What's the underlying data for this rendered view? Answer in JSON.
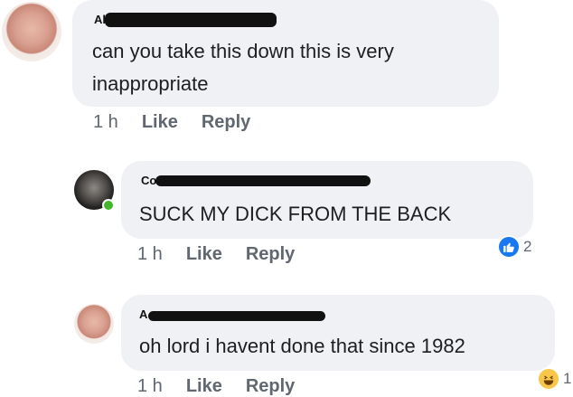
{
  "comments": [
    {
      "author": "Al",
      "text_lines": [
        "can you take this down this is very",
        "inappropriate"
      ],
      "time": "1 h",
      "like_label": "Like",
      "reply_label": "Reply"
    },
    {
      "author": "Co",
      "text_lines": [
        "SUCK MY DICK FROM THE BACK"
      ],
      "time": "1 h",
      "like_label": "Like",
      "reply_label": "Reply",
      "reaction": {
        "icon": "thumbs-up-icon",
        "count": "2",
        "color": "#1877f2"
      }
    },
    {
      "author": "A",
      "text_lines": [
        "oh lord i havent done that since 1982"
      ],
      "time": "1 h",
      "like_label": "Like",
      "reply_label": "Reply",
      "reaction": {
        "icon": "laughing-emoji-icon",
        "count": "1",
        "color": "#f7c64a"
      }
    }
  ]
}
